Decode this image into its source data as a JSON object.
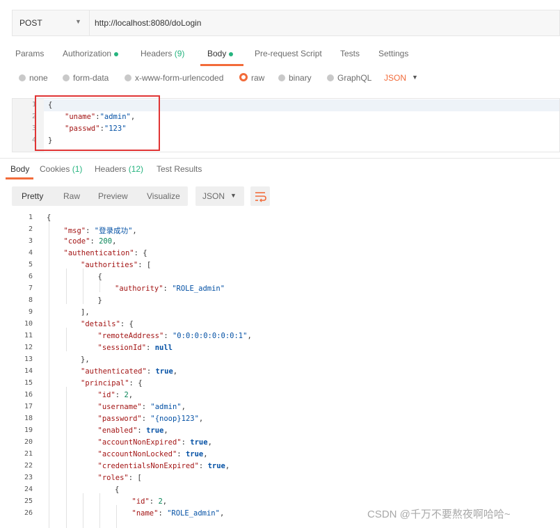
{
  "request": {
    "method": "POST",
    "url": "http://localhost:8080/doLogin"
  },
  "request_tabs": {
    "params": "Params",
    "authorization": "Authorization",
    "headers": "Headers",
    "headers_count": "(9)",
    "body": "Body",
    "pre_request": "Pre-request Script",
    "tests": "Tests",
    "settings": "Settings"
  },
  "body_types": {
    "none": "none",
    "form_data": "form-data",
    "urlencoded": "x-www-form-urlencoded",
    "raw": "raw",
    "binary": "binary",
    "graphql": "GraphQL",
    "format": "JSON",
    "selected": "raw"
  },
  "request_body": {
    "line_numbers": [
      "1",
      "2",
      "3",
      "4"
    ],
    "l1": "{",
    "l2_key": "\"uname\"",
    "l2_sep": ":",
    "l2_val": "\"admin\"",
    "l2_end": ",",
    "l3_key": "\"passwd\"",
    "l3_sep": ":",
    "l3_val": "\"123\"",
    "l4": "}"
  },
  "response_tabs": {
    "body": "Body",
    "cookies": "Cookies",
    "cookies_count": "(1)",
    "headers": "Headers",
    "headers_count": "(12)",
    "test_results": "Test Results"
  },
  "response_toolbar": {
    "pretty": "Pretty",
    "raw": "Raw",
    "preview": "Preview",
    "visualize": "Visualize",
    "format": "JSON"
  },
  "response_lines": [
    {
      "n": "1",
      "t": [
        [
          "p",
          "{"
        ]
      ]
    },
    {
      "n": "2",
      "t": [
        [
          "k",
          "\"msg\""
        ],
        [
          "p",
          ": "
        ],
        [
          "s",
          "\"登录成功\""
        ],
        [
          "p",
          ","
        ]
      ]
    },
    {
      "n": "3",
      "t": [
        [
          "k",
          "\"code\""
        ],
        [
          "p",
          ": "
        ],
        [
          "n",
          "200"
        ],
        [
          "p",
          ","
        ]
      ]
    },
    {
      "n": "4",
      "t": [
        [
          "k",
          "\"authentication\""
        ],
        [
          "p",
          ": {"
        ]
      ]
    },
    {
      "n": "5",
      "t": [
        [
          "k",
          "\"authorities\""
        ],
        [
          "p",
          ": ["
        ]
      ]
    },
    {
      "n": "6",
      "t": [
        [
          "p",
          "{"
        ]
      ]
    },
    {
      "n": "7",
      "t": [
        [
          "k",
          "\"authority\""
        ],
        [
          "p",
          ": "
        ],
        [
          "s",
          "\"ROLE_admin\""
        ]
      ]
    },
    {
      "n": "8",
      "t": [
        [
          "p",
          "}"
        ]
      ]
    },
    {
      "n": "9",
      "t": [
        [
          "p",
          "],"
        ]
      ]
    },
    {
      "n": "10",
      "t": [
        [
          "k",
          "\"details\""
        ],
        [
          "p",
          ": {"
        ]
      ]
    },
    {
      "n": "11",
      "t": [
        [
          "k",
          "\"remoteAddress\""
        ],
        [
          "p",
          ": "
        ],
        [
          "s",
          "\"0:0:0:0:0:0:0:1\""
        ],
        [
          "p",
          ","
        ]
      ]
    },
    {
      "n": "12",
      "t": [
        [
          "k",
          "\"sessionId\""
        ],
        [
          "p",
          ": "
        ],
        [
          "b",
          "null"
        ]
      ]
    },
    {
      "n": "13",
      "t": [
        [
          "p",
          "},"
        ]
      ]
    },
    {
      "n": "14",
      "t": [
        [
          "k",
          "\"authenticated\""
        ],
        [
          "p",
          ": "
        ],
        [
          "b",
          "true"
        ],
        [
          "p",
          ","
        ]
      ]
    },
    {
      "n": "15",
      "t": [
        [
          "k",
          "\"principal\""
        ],
        [
          "p",
          ": {"
        ]
      ]
    },
    {
      "n": "16",
      "t": [
        [
          "k",
          "\"id\""
        ],
        [
          "p",
          ": "
        ],
        [
          "n",
          "2"
        ],
        [
          "p",
          ","
        ]
      ]
    },
    {
      "n": "17",
      "t": [
        [
          "k",
          "\"username\""
        ],
        [
          "p",
          ": "
        ],
        [
          "s",
          "\"admin\""
        ],
        [
          "p",
          ","
        ]
      ]
    },
    {
      "n": "18",
      "t": [
        [
          "k",
          "\"password\""
        ],
        [
          "p",
          ": "
        ],
        [
          "s",
          "\"{noop}123\""
        ],
        [
          "p",
          ","
        ]
      ]
    },
    {
      "n": "19",
      "t": [
        [
          "k",
          "\"enabled\""
        ],
        [
          "p",
          ": "
        ],
        [
          "b",
          "true"
        ],
        [
          "p",
          ","
        ]
      ]
    },
    {
      "n": "20",
      "t": [
        [
          "k",
          "\"accountNonExpired\""
        ],
        [
          "p",
          ": "
        ],
        [
          "b",
          "true"
        ],
        [
          "p",
          ","
        ]
      ]
    },
    {
      "n": "21",
      "t": [
        [
          "k",
          "\"accountNonLocked\""
        ],
        [
          "p",
          ": "
        ],
        [
          "b",
          "true"
        ],
        [
          "p",
          ","
        ]
      ]
    },
    {
      "n": "22",
      "t": [
        [
          "k",
          "\"credentialsNonExpired\""
        ],
        [
          "p",
          ": "
        ],
        [
          "b",
          "true"
        ],
        [
          "p",
          ","
        ]
      ]
    },
    {
      "n": "23",
      "t": [
        [
          "k",
          "\"roles\""
        ],
        [
          "p",
          ": ["
        ]
      ]
    },
    {
      "n": "24",
      "t": [
        [
          "p",
          "{"
        ]
      ]
    },
    {
      "n": "25",
      "t": [
        [
          "k",
          "\"id\""
        ],
        [
          "p",
          ": "
        ],
        [
          "n",
          "2"
        ],
        [
          "p",
          ","
        ]
      ]
    },
    {
      "n": "26",
      "t": [
        [
          "k",
          "\"name\""
        ],
        [
          "p",
          ": "
        ],
        [
          "s",
          "\"ROLE_admin\""
        ],
        [
          "p",
          ","
        ]
      ]
    }
  ],
  "watermark": "CSDN @千万不要熬夜啊哈哈~",
  "colors": {
    "accent": "#f26b3a",
    "count_green": "#26b47f",
    "highlight_red": "#e03434",
    "json_key": "#a31515",
    "json_string": "#0451a5",
    "json_number": "#098658"
  },
  "icons": [
    "chevron-down-icon",
    "radio-icon",
    "status-dot-icon",
    "wrap-lines-icon"
  ]
}
